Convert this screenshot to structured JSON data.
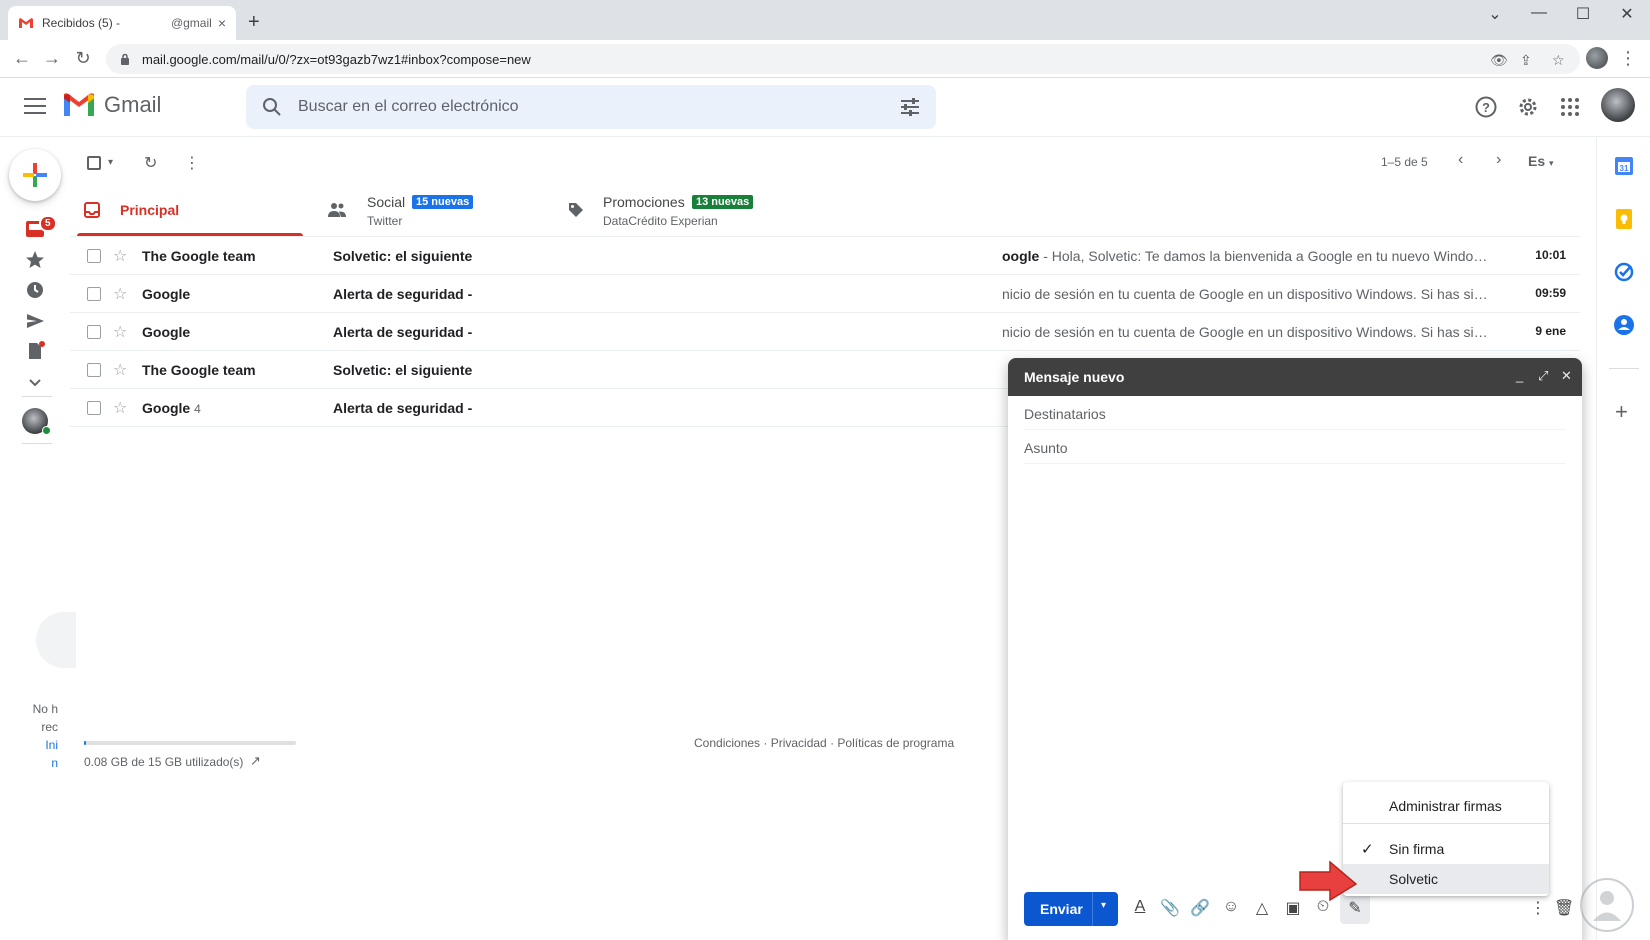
{
  "browser": {
    "tab_title": "Recibidos (5) -",
    "tab_title_tail": "@gmail",
    "close_glyph": "×",
    "new_tab_glyph": "+",
    "url": "mail.google.com/mail/u/0/?zx=ot93gazb7wz1#inbox?compose=new",
    "window_controls": [
      "⌄",
      "—",
      "☐",
      "✕"
    ],
    "nav": {
      "back": "←",
      "forward": "→",
      "reload": "↻",
      "menu": "⋮"
    },
    "omni_icons": [
      "👁",
      "⇪",
      "☆"
    ]
  },
  "gmail": {
    "logo_text": "Gmail",
    "search_placeholder": "Buscar en el correo electrónico",
    "header_icons": [
      "help-icon",
      "settings-icon",
      "apps-icon",
      "account-avatar"
    ],
    "left_nav": {
      "inbox_badge": "5",
      "hint_lines": [
        "No h",
        "rec",
        "Ini",
        "n"
      ]
    },
    "list_toolbar": {
      "pager_text": "1–5 de 5",
      "lang": "Es",
      "prev": "‹",
      "next": "›",
      "more": "⋮",
      "refresh": "↻",
      "select_caret": "▾"
    },
    "category_tabs": [
      {
        "label": "Principal",
        "sub": "",
        "pill": "",
        "active": true
      },
      {
        "label": "Social",
        "sub": "Twitter",
        "pill": "15 nuevas",
        "pill_color": "#1a73e8"
      },
      {
        "label": "Promociones",
        "sub": "DataCrédito Experian",
        "pill": "13 nuevas",
        "pill_color": "#188038"
      }
    ],
    "emails": [
      {
        "sender": "The Google team",
        "count": "",
        "subject": "Solvetic: el siguiente",
        "snippet_bold": "oogle",
        "snippet": " - Hola, Solvetic: Te damos la bienvenida a Google en tu nuevo Windo…",
        "time": "10:01"
      },
      {
        "sender": "Google",
        "count": "",
        "subject": "Alerta de seguridad -",
        "snippet_bold": "",
        "snippet": "nicio de sesión en tu cuenta de Google en un dispositivo Windows. Si has si…",
        "time": "09:59"
      },
      {
        "sender": "Google",
        "count": "",
        "subject": "Alerta de seguridad -",
        "snippet_bold": "",
        "snippet": "nicio de sesión en tu cuenta de Google en un dispositivo Windows. Si has si…",
        "time": "9 ene"
      },
      {
        "sender": "The Google team",
        "count": "",
        "subject": "Solvetic: el siguiente",
        "snippet_bold": "",
        "snippet": "",
        "time": ""
      },
      {
        "sender": "Google",
        "count": "4",
        "subject": "Alerta de seguridad -",
        "snippet_bold": "",
        "snippet": "",
        "time": ""
      }
    ],
    "storage": {
      "text": "0.08 GB de 15 GB utilizado(s)",
      "used_fraction": 0.005
    },
    "footer": "Condiciones · Privacidad · Políticas de programa"
  },
  "compose": {
    "title": "Mensaje nuevo",
    "header_controls": [
      "_",
      "⤢",
      "✕"
    ],
    "to_placeholder": "Destinatarios",
    "subject_placeholder": "Asunto",
    "send_label": "Enviar",
    "send_caret": "▾",
    "format_tools": [
      "A",
      "📎",
      "🔗",
      "☺",
      "△",
      "▣",
      "⏲",
      "✎"
    ],
    "more": "⋮",
    "trash": "🗑"
  },
  "signature_menu": {
    "manage": "Administrar firmas",
    "items": [
      {
        "label": "Sin firma",
        "checked": true
      },
      {
        "label": "Solvetic",
        "checked": false
      }
    ],
    "check_glyph": "✓"
  },
  "colors": {
    "gmail_red": "#d93025",
    "send_blue": "#0b57d0",
    "compose_header": "#404040",
    "annotation_arrow": "#e8403e"
  }
}
